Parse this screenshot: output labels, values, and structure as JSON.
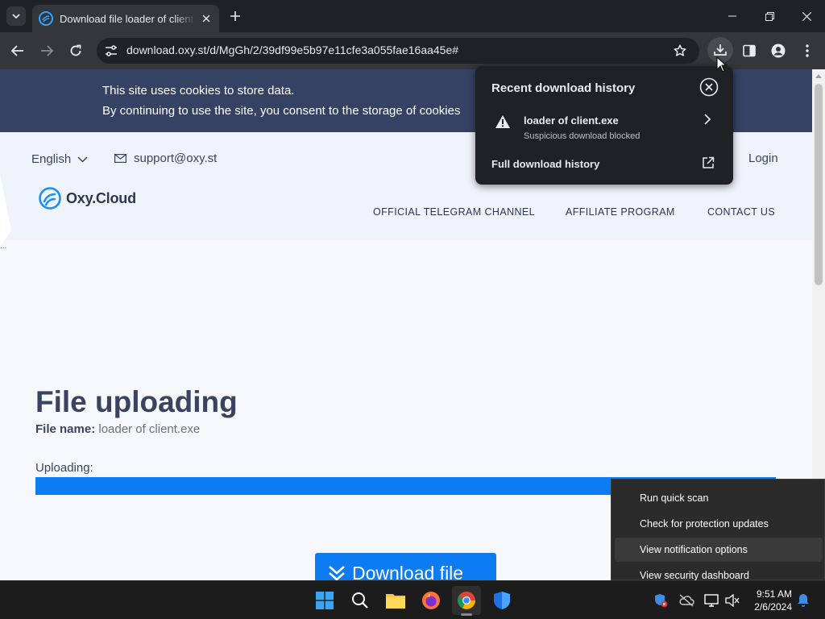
{
  "browser": {
    "tab_title": "Download file loader of client.exe",
    "url": "download.oxy.st/d/MgGh/2/39df99e5b97e11cfe3a055fae16aa45e#"
  },
  "cookie_banner": {
    "line1": "This site uses cookies to store data.",
    "line2": "By continuing to use the site, you consent to the storage of cookies"
  },
  "header": {
    "language": "English",
    "support_email": "support@oxy.st",
    "login": "Login",
    "logo": "Oxy.Cloud",
    "menu": [
      "OFFICIAL TELEGRAM CHANNEL",
      "AFFILIATE PROGRAM",
      "CONTACT US"
    ]
  },
  "main": {
    "title": "File uploading",
    "file_name_label": "File name:",
    "file_name": "loader of client.exe",
    "uploading_label": "Uploading:",
    "progress_fraction": 1.0,
    "download_button": "Download file"
  },
  "download_popup": {
    "title": "Recent download history",
    "item_name": "loader of client.exe",
    "item_status": "Suspicious download blocked",
    "full_history": "Full download history"
  },
  "context_menu": {
    "items": [
      "Run quick scan",
      "Check for protection updates",
      "View notification options",
      "View security dashboard"
    ],
    "highlighted_index": 2
  },
  "taskbar": {
    "time": "9:51 AM",
    "date": "2/6/2024"
  },
  "colors": {
    "accent_blue": "#0d7cf2",
    "cookie_banner": "#354263",
    "page_bg": "#f7f8fb"
  }
}
